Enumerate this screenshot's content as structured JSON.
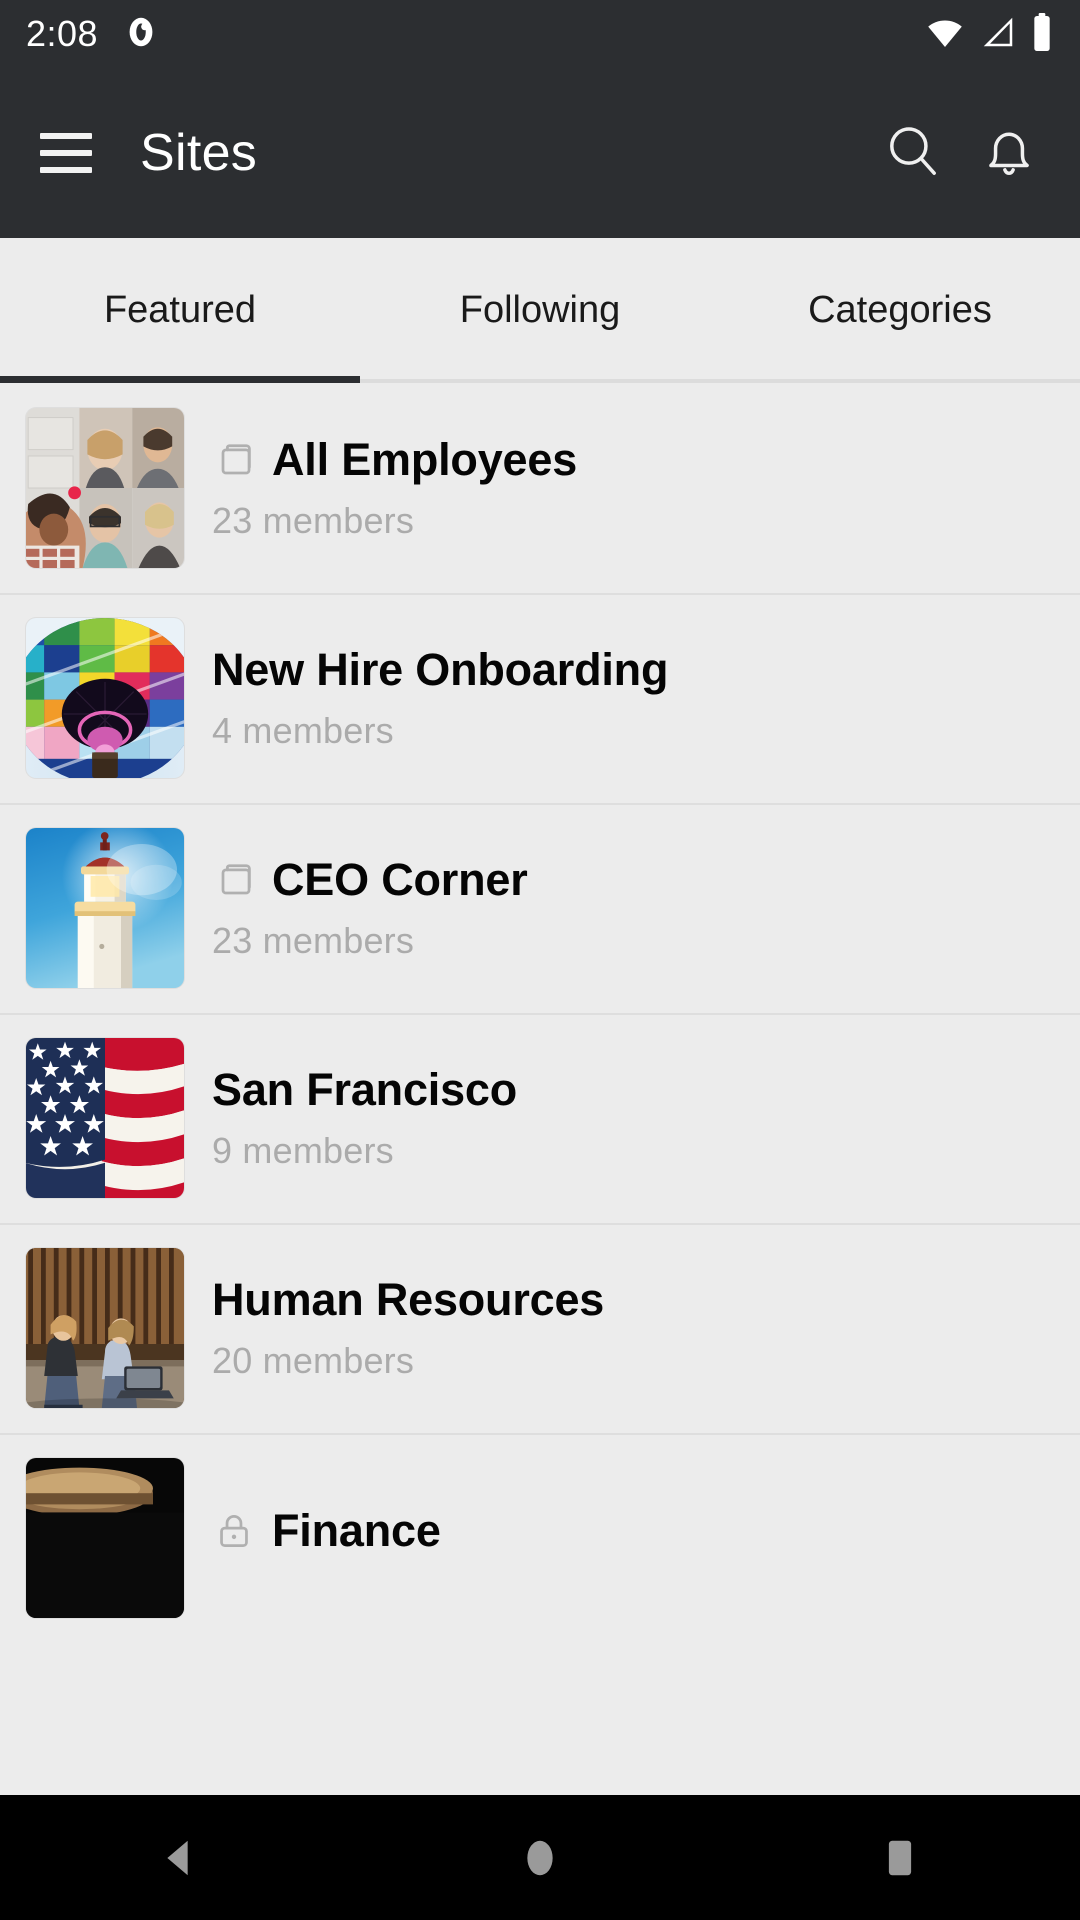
{
  "status_bar": {
    "time": "2:08",
    "icons": [
      "notification-dot-icon",
      "wifi-icon",
      "cellular-signal-icon",
      "battery-icon"
    ]
  },
  "app_bar": {
    "title": "Sites",
    "menu_icon": "hamburger-menu-icon",
    "search_icon": "search-icon",
    "notifications_icon": "bell-icon"
  },
  "tabs": {
    "active_index": 0,
    "items": [
      {
        "label": "Featured"
      },
      {
        "label": "Following"
      },
      {
        "label": "Categories"
      }
    ]
  },
  "sites": [
    {
      "title": "All Employees",
      "members": "23 members",
      "type_icon": "site-pages-icon",
      "thumbnail": "video-conference-grid-photo"
    },
    {
      "title": "New Hire Onboarding",
      "members": "4 members",
      "type_icon": "",
      "thumbnail": "rainbow-hot-air-balloon-photo"
    },
    {
      "title": "CEO Corner",
      "members": "23 members",
      "type_icon": "site-pages-icon",
      "thumbnail": "lighthouse-blue-sky-photo"
    },
    {
      "title": "San Francisco",
      "members": "9 members",
      "type_icon": "",
      "thumbnail": "american-flag-photo"
    },
    {
      "title": "Human Resources",
      "members": "20 members",
      "type_icon": "",
      "thumbnail": "two-people-with-laptop-photo"
    },
    {
      "title": "Finance",
      "members": "",
      "type_icon": "lock-icon",
      "thumbnail": "dark-table-photo"
    }
  ],
  "nav_bar": {
    "back_label": "back-button",
    "home_label": "home-button",
    "recents_label": "recents-button"
  },
  "colors": {
    "chrome_dark": "#2c2e31",
    "page_bg": "#ececec",
    "title_text": "#050505",
    "muted_text": "#ababab",
    "divider": "#dedede",
    "nav_bg": "#000000"
  }
}
